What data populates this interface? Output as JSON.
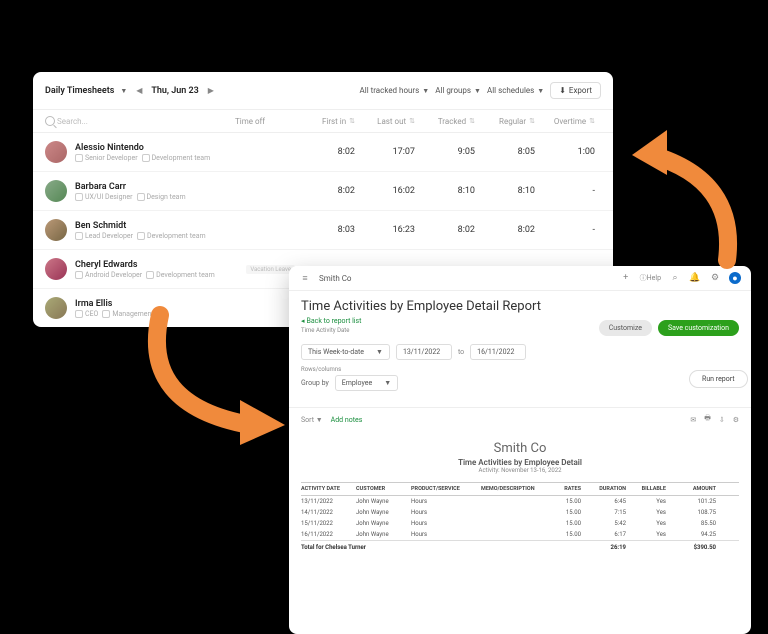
{
  "timesheet": {
    "view": "Daily Timesheets",
    "date": "Thu, Jun 23",
    "filters": {
      "hours": "All tracked hours",
      "groups": "All groups",
      "schedules": "All schedules"
    },
    "export": "Export",
    "search_placeholder": "Search...",
    "cols": {
      "timeoff": "Time off",
      "firstin": "First in",
      "lastout": "Last out",
      "tracked": "Tracked",
      "regular": "Regular",
      "overtime": "Overtime"
    },
    "rows": [
      {
        "name": "Alessio Nintendo",
        "role": "Senior Developer",
        "team": "Development team",
        "firstin": "8:02",
        "lastout": "17:07",
        "tracked": "9:05",
        "regular": "8:05",
        "overtime": "1:00"
      },
      {
        "name": "Barbara Carr",
        "role": "UX/UI Designer",
        "team": "Design team",
        "firstin": "8:02",
        "lastout": "16:02",
        "tracked": "8:10",
        "regular": "8:10",
        "overtime": "-"
      },
      {
        "name": "Ben Schmidt",
        "role": "Lead Developer",
        "team": "Development team",
        "firstin": "8:03",
        "lastout": "16:23",
        "tracked": "8:02",
        "regular": "8:02",
        "overtime": "-"
      },
      {
        "name": "Cheryl Edwards",
        "role": "Android Developer",
        "team": "Development team",
        "vacation": "Vacation Leave"
      },
      {
        "name": "Irma Ellis",
        "role": "CEO",
        "team": "Management"
      }
    ]
  },
  "qb": {
    "company": "Smith Co",
    "help": "Help",
    "title": "Time Activities by Employee Detail Report",
    "back": "Back to report list",
    "date_label": "Time Activity Date",
    "range_select": "This Week-to-date",
    "from": "13/11/2022",
    "to_label": "to",
    "to": "16/11/2022",
    "rows_label": "Rows/columns",
    "group_by": "Group by",
    "group_val": "Employee",
    "run": "Run report",
    "customize": "Customize",
    "save": "Save customization",
    "sort": "Sort",
    "add_notes": "Add notes",
    "report": {
      "co": "Smith Co",
      "sub": "Time Activities by Employee Detail",
      "period": "Activity: November 13-16, 2022",
      "cols": [
        "ACTIVITY DATE",
        "CUSTOMER",
        "PRODUCT/SERVICE",
        "MEMO/DESCRIPTION",
        "RATES",
        "DURATION",
        "BILLABLE",
        "AMOUNT"
      ],
      "rows": [
        {
          "date": "13/11/2022",
          "cust": "John Wayne",
          "prod": "Hours",
          "rate": "15.00",
          "dur": "6:45",
          "bill": "Yes",
          "amt": "101.25"
        },
        {
          "date": "14/11/2022",
          "cust": "John Wayne",
          "prod": "Hours",
          "rate": "15.00",
          "dur": "7:15",
          "bill": "Yes",
          "amt": "108.75"
        },
        {
          "date": "15/11/2022",
          "cust": "John Wayne",
          "prod": "Hours",
          "rate": "15.00",
          "dur": "5:42",
          "bill": "Yes",
          "amt": "85.50"
        },
        {
          "date": "16/11/2022",
          "cust": "John Wayne",
          "prod": "Hours",
          "rate": "15.00",
          "dur": "6:17",
          "bill": "Yes",
          "amt": "94.25"
        }
      ],
      "total_label": "Total for Chelsea Turner",
      "total_dur": "26:19",
      "total_amt": "$390.50"
    }
  }
}
